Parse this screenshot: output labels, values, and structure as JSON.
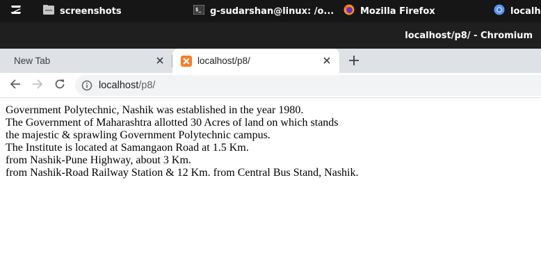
{
  "taskbar": {
    "items": [
      {
        "label": "",
        "icon": "zorin-logo-icon"
      },
      {
        "label": "screenshots",
        "icon": "folder-icon"
      },
      {
        "label": "g-sudarshan@linux: /o...",
        "icon": "terminal-icon"
      },
      {
        "label": "Mozilla Firefox",
        "icon": "firefox-icon"
      },
      {
        "label": "localho",
        "icon": "chromium-icon"
      }
    ]
  },
  "window": {
    "title": "localhost/p8/ - Chromium"
  },
  "tabs": [
    {
      "label": "New Tab",
      "active": false
    },
    {
      "label": "localhost/p8/",
      "active": true,
      "icon": "xampp-icon"
    }
  ],
  "toolbar": {
    "url_host": "localhost",
    "url_path": "/p8/"
  },
  "page": {
    "lines": [
      "Government Polytechnic, Nashik was established in the year 1980.",
      "The Government of Maharashtra allotted 30 Acres of land on which stands",
      "the majestic & sprawling Government Polytechnic campus.",
      "The Institute is located at Samangaon Road at 1.5 Km.",
      "from Nashik-Pune Highway, about 3 Km.",
      "from Nashik-Road Railway Station & 12 Km. from Central Bus Stand, Nashik."
    ]
  },
  "colors": {
    "taskbar_bg": "#161616",
    "titlebar_bg": "#1f1f1f",
    "tabstrip_bg": "#dee1e6",
    "xampp_orange": "#fb7a24"
  }
}
